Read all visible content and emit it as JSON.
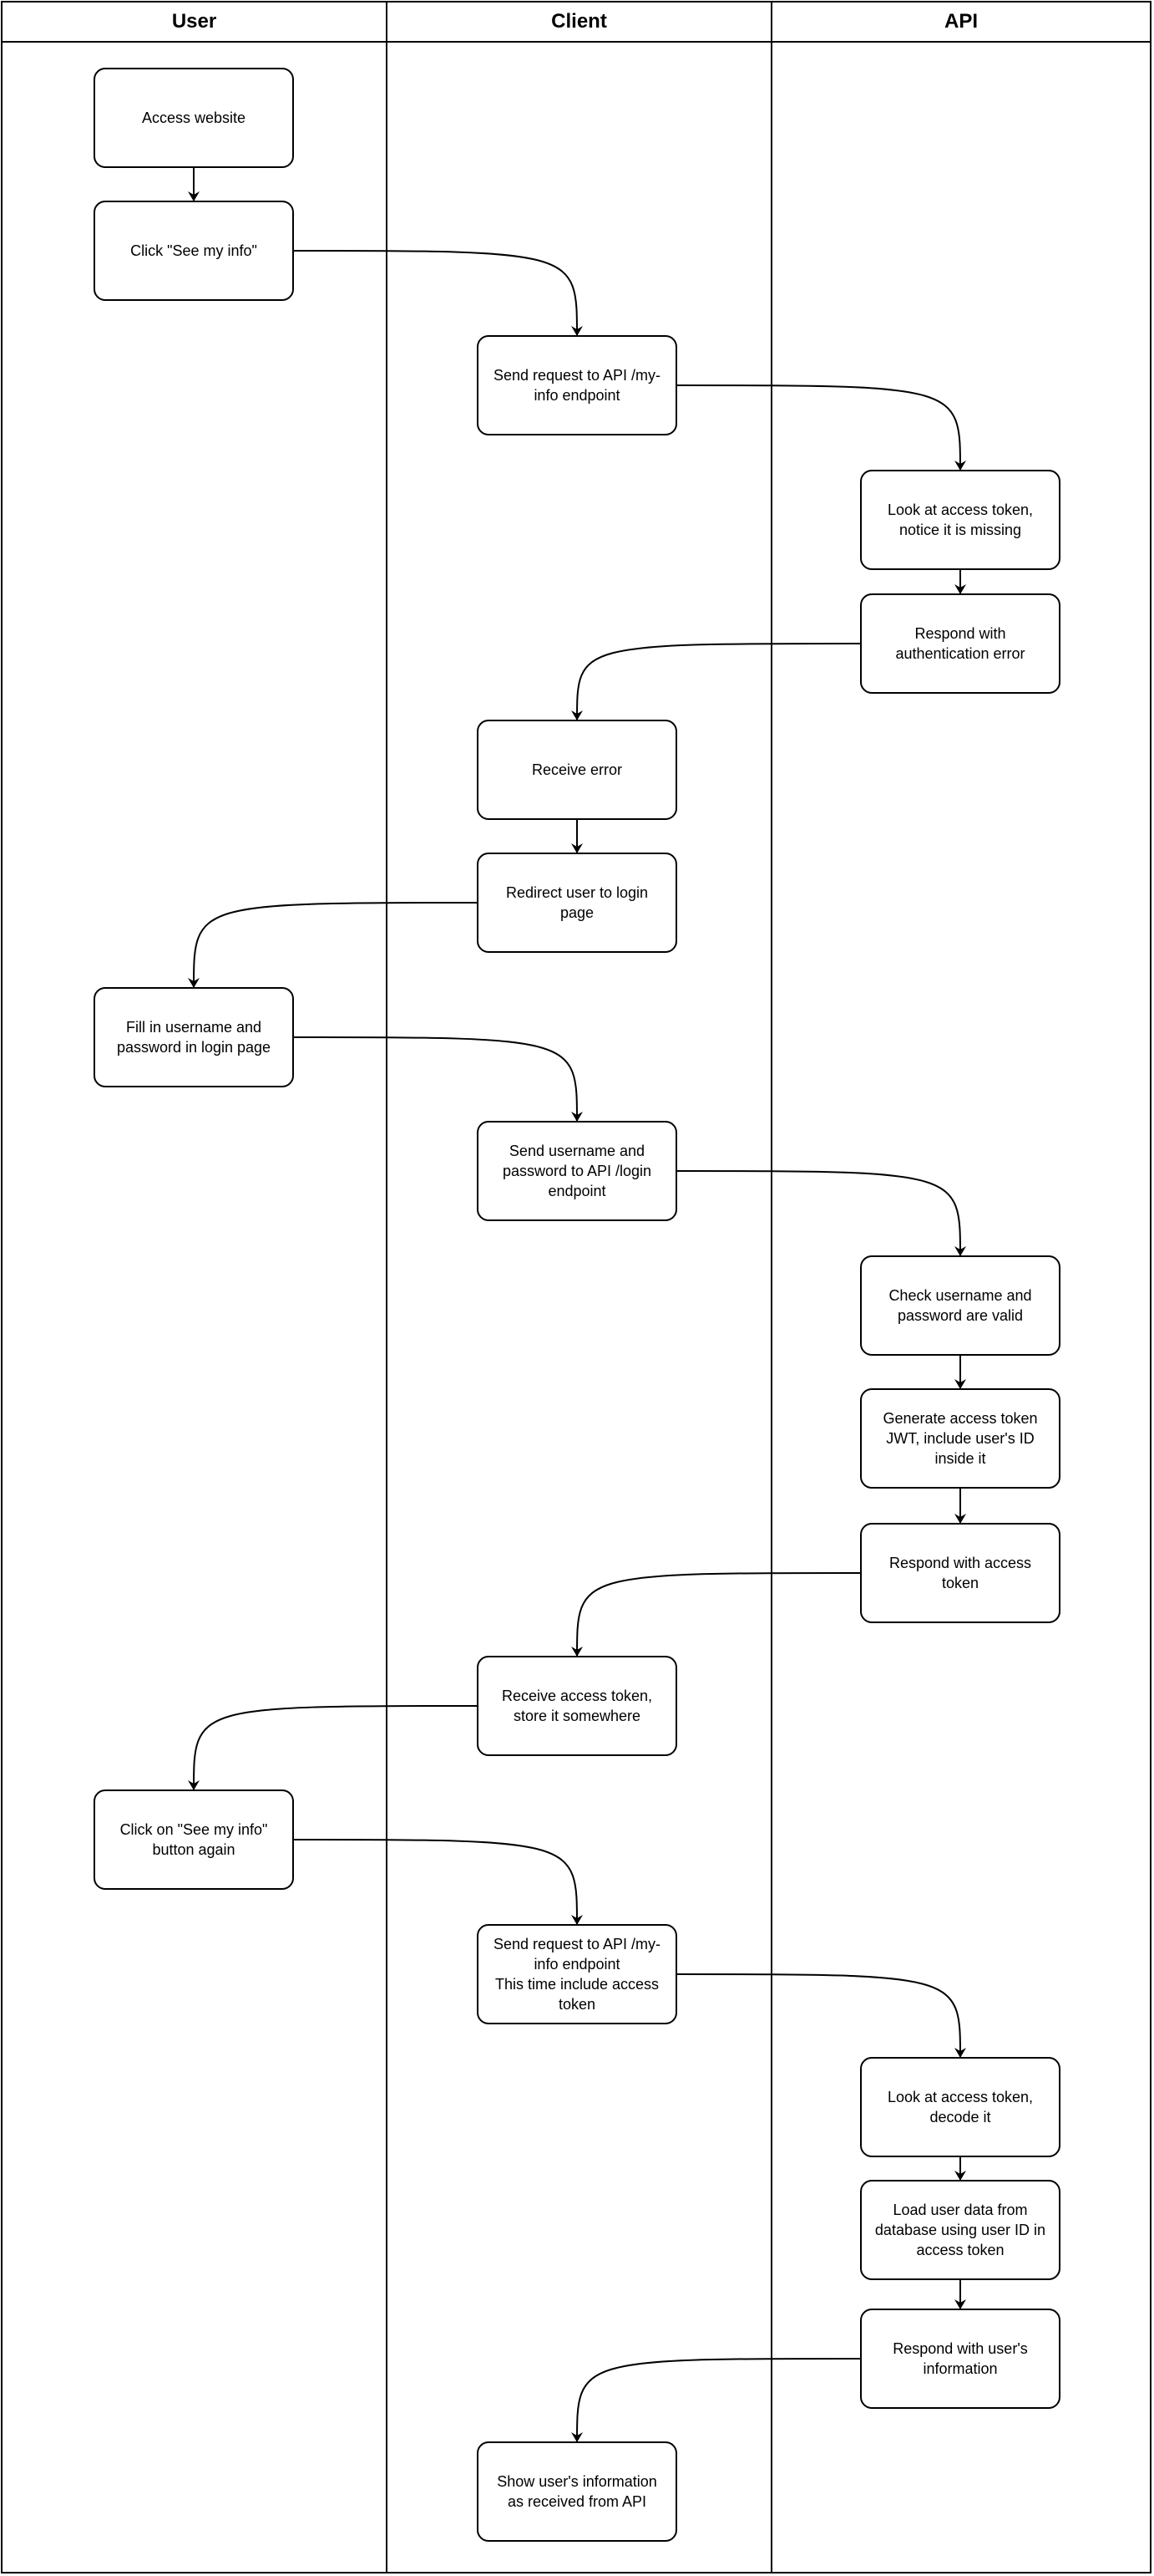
{
  "lanes": [
    "User",
    "Client",
    "API"
  ],
  "nodes": [
    {
      "lane": 0,
      "text": "Access website"
    },
    {
      "lane": 0,
      "text": "Click \"See my info\""
    },
    {
      "lane": 1,
      "text": "Send request to API /my-\ninfo endpoint"
    },
    {
      "lane": 2,
      "text": "Look at access token,\nnotice it is missing"
    },
    {
      "lane": 2,
      "text": "Respond with\nauthentication error"
    },
    {
      "lane": 1,
      "text": "Receive error"
    },
    {
      "lane": 1,
      "text": "Redirect user to login\npage"
    },
    {
      "lane": 0,
      "text": "Fill in username and\npassword in login page"
    },
    {
      "lane": 1,
      "text": "Send username and\npassword to API /login\nendpoint"
    },
    {
      "lane": 2,
      "text": "Check username and\npassword are valid"
    },
    {
      "lane": 2,
      "text": "Generate access token\nJWT, include user's ID\ninside it"
    },
    {
      "lane": 2,
      "text": "Respond with access\ntoken"
    },
    {
      "lane": 1,
      "text": "Receive access token,\nstore it somewhere"
    },
    {
      "lane": 0,
      "text": "Click on \"See my info\"\nbutton again"
    },
    {
      "lane": 1,
      "text": "Send request to API /my-\ninfo endpoint\nThis time include access\ntoken"
    },
    {
      "lane": 2,
      "text": "Look at access token,\ndecode it"
    },
    {
      "lane": 2,
      "text": "Load user data from\ndatabase using user ID in\naccess token"
    },
    {
      "lane": 2,
      "text": "Respond with user's\ninformation"
    },
    {
      "lane": 1,
      "text": "Show user's information\nas received from API"
    }
  ],
  "edges": [
    [
      0,
      1
    ],
    [
      1,
      2
    ],
    [
      2,
      3
    ],
    [
      3,
      4
    ],
    [
      4,
      5
    ],
    [
      5,
      6
    ],
    [
      6,
      7
    ],
    [
      7,
      8
    ],
    [
      8,
      9
    ],
    [
      9,
      10
    ],
    [
      10,
      11
    ],
    [
      11,
      12
    ],
    [
      12,
      13
    ],
    [
      13,
      14
    ],
    [
      14,
      15
    ],
    [
      15,
      16
    ],
    [
      16,
      17
    ],
    [
      17,
      18
    ]
  ]
}
